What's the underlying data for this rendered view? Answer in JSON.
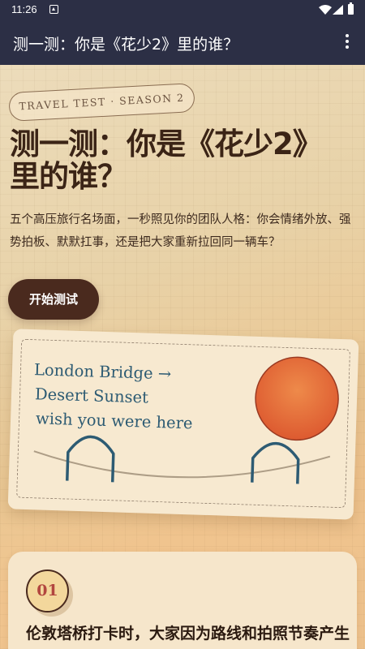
{
  "status_bar": {
    "time": "11:26"
  },
  "app_bar": {
    "title": "测一测：你是《花少2》里的谁？"
  },
  "hero": {
    "tag": "TRAVEL TEST · SEASON 2",
    "title": "测一测：你是《花少2》里的谁？",
    "description": "五个高压旅行名场面，一秒照见你的团队人格：你会情绪外放、强势拍板、默默扛事，还是把大家重新拉回同一辆车？",
    "start_button": "开始测试"
  },
  "postcard": {
    "line1": "London Bridge →",
    "line2": "Desert Sunset",
    "line3": "wish you were here"
  },
  "question": {
    "number": "01",
    "text": "伦敦塔桥打卡时，大家因为路线和拍照节奏产生分歧，你通常会..."
  },
  "colors": {
    "app_bar": "#2c2f45",
    "button": "#4a2a1e",
    "accent_text": "#2d5b73",
    "sun": "#e4663a"
  }
}
